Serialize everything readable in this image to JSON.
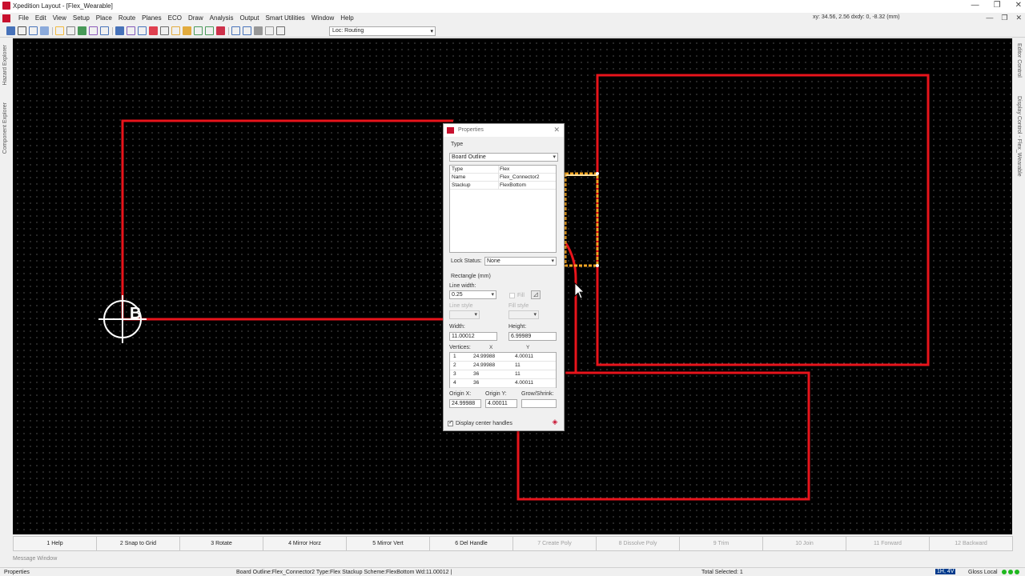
{
  "window": {
    "title": "Xpedition Layout - [Flex_Wearable]",
    "minimize": "—",
    "restore": "❐",
    "close": "✕"
  },
  "menu": {
    "items": [
      "File",
      "Edit",
      "View",
      "Setup",
      "Place",
      "Route",
      "Planes",
      "ECO",
      "Draw",
      "Analysis",
      "Output",
      "Smart Utilities",
      "Window",
      "Help"
    ],
    "coords": "xy: 34.56, 2.56  dxdy: 0, -8.32  (mm)"
  },
  "toolbar": {
    "lock_value": "Loc: Routing",
    "icons": [
      "save-icon",
      "binoculars-icon",
      "undo-icon",
      "redo-icon",
      "highlight-icon",
      "unhighlight-icon",
      "display-control-icon",
      "properties-icon",
      "grid-icon",
      "select-mode-icon",
      "place-mode-icon",
      "route-mode-icon",
      "plane-mode-icon",
      "draw-mode-icon",
      "gloss-icon",
      "tune-icon",
      "fanout-icon",
      "via-icon",
      "drc-icon",
      "zoom-in-icon",
      "zoom-out-icon",
      "pan-icon",
      "fit-icon",
      "pick-icon"
    ],
    "colors": [
      "#2a5db0",
      "#333",
      "#2a5db0",
      "#7a9ed8",
      "#f2b01e",
      "#6e6e6e",
      "#2b8a3e",
      "#7a3fb0",
      "#2a5db0",
      "#2a5db0",
      "#6e3fb0",
      "#2a5db0",
      "#d23",
      "#555",
      "#e0a020",
      "#e0a020",
      "#2b8a3e",
      "#2b8a3e",
      "#c8102e",
      "#2a5db0",
      "#2a5db0",
      "#888",
      "#888",
      "#555"
    ]
  },
  "side_panels": {
    "left": [
      "Hazard Explorer",
      "Component Explorer"
    ],
    "right": [
      "Editor Control",
      "Display Control - Flex_Wearable"
    ]
  },
  "canvas": {
    "origin_marker": "B",
    "colors": {
      "outline": "#e8141b",
      "selected": "#f5a623",
      "background": "#000000"
    }
  },
  "properties": {
    "title": "Properties",
    "type_label": "Type",
    "type_value": "Board Outline",
    "attributes": [
      {
        "key": "Type",
        "value": "Flex"
      },
      {
        "key": "Name",
        "value": "Flex_Connector2"
      },
      {
        "key": "Stackup",
        "value": "FlexBottom"
      }
    ],
    "lock_label": "Lock Status:",
    "lock_value": "None",
    "shape_label": "Rectangle (mm)",
    "line_width_label": "Line width:",
    "line_width_value": "0.25",
    "fill_label": "Fill",
    "line_style_label": "Line style",
    "fill_style_label": "Fill style",
    "width_label": "Width:",
    "width_value": "11.00012",
    "height_label": "Height:",
    "height_value": "6.99989",
    "vertices_label": "Vertices:",
    "x_header": "X",
    "y_header": "Y",
    "vertices": [
      {
        "n": "1",
        "x": "24.99988",
        "y": "4.00011"
      },
      {
        "n": "2",
        "x": "24.99988",
        "y": "11"
      },
      {
        "n": "3",
        "x": "36",
        "y": "11"
      },
      {
        "n": "4",
        "x": "36",
        "y": "4.00011"
      }
    ],
    "origin_x_label": "Origin X:",
    "origin_x_value": "24.99988",
    "origin_y_label": "Origin Y:",
    "origin_y_value": "4.00011",
    "grow_label": "Grow/Shrink:",
    "grow_value": "",
    "center_handles_label": "Display center handles",
    "center_handles_checked": true
  },
  "fkeys": [
    {
      "label": "1 Help",
      "enabled": true
    },
    {
      "label": "2 Snap to Grid",
      "enabled": true
    },
    {
      "label": "3 Rotate",
      "enabled": true
    },
    {
      "label": "4 Mirror Horz",
      "enabled": true
    },
    {
      "label": "5 Mirror Vert",
      "enabled": true
    },
    {
      "label": "6 Del Handle",
      "enabled": true
    },
    {
      "label": "7 Create Poly",
      "enabled": false
    },
    {
      "label": "8 Dissolve Poly",
      "enabled": false
    },
    {
      "label": "9 Trim",
      "enabled": false
    },
    {
      "label": "10 Join",
      "enabled": false
    },
    {
      "label": "11 Forward",
      "enabled": false
    },
    {
      "label": "12 Backward",
      "enabled": false
    }
  ],
  "message_window": "Message Window",
  "status": {
    "left": "Properties",
    "center": "Board Outline:Flex_Connector2 Type:Flex Stackup Scheme:FlexBottom Wd:11.00012 |",
    "selected": "Total Selected: 1",
    "layer": "1H, 4V",
    "gloss": "Gloss Local"
  }
}
